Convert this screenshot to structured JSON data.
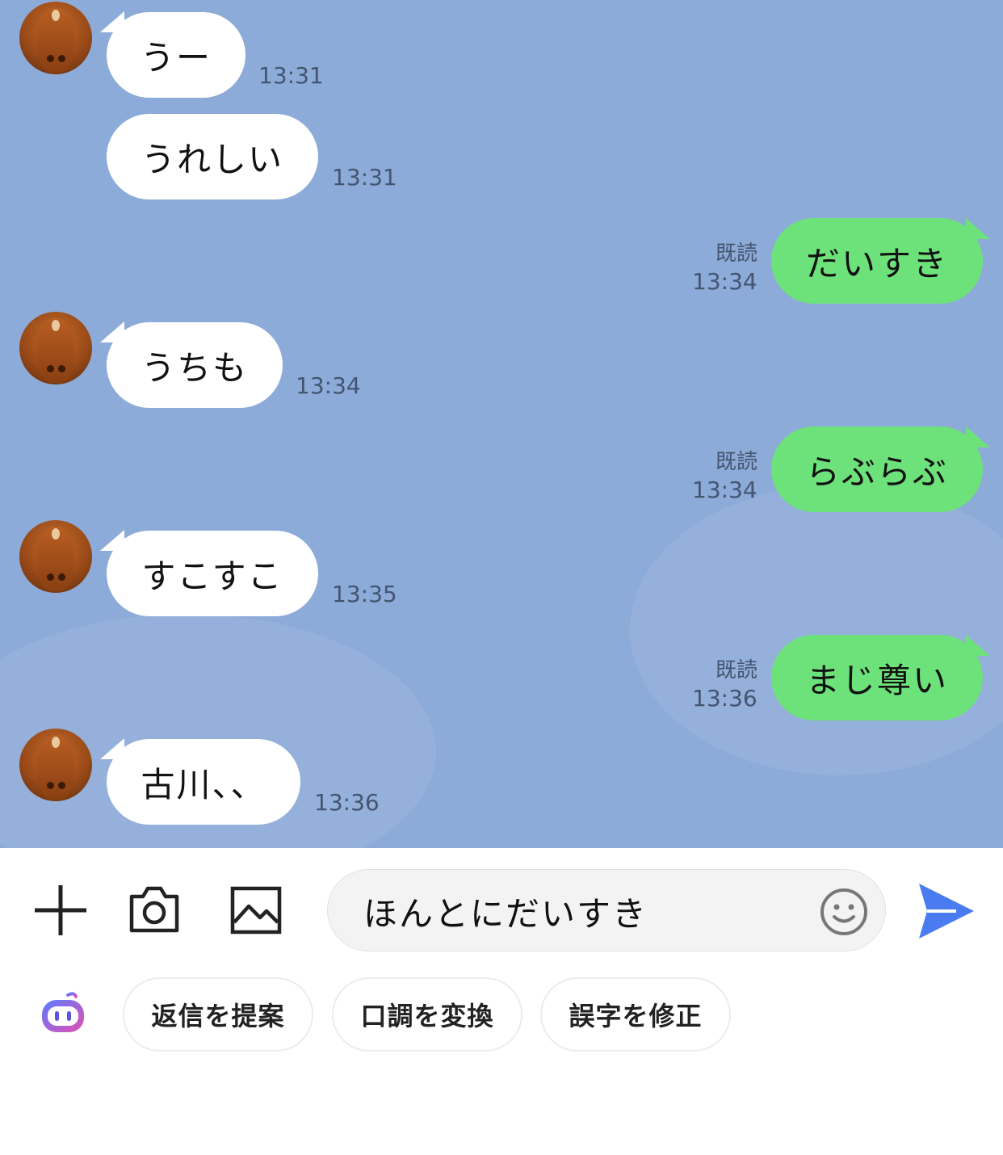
{
  "messages": [
    {
      "side": "in",
      "text": "うー",
      "time": "13:31",
      "avatar": true
    },
    {
      "side": "in",
      "text": "うれしい",
      "time": "13:31",
      "avatar": false
    },
    {
      "side": "out",
      "text": "だいすき",
      "time": "13:34",
      "read": "既読"
    },
    {
      "side": "in",
      "text": "うちも",
      "time": "13:34",
      "avatar": true
    },
    {
      "side": "out",
      "text": "らぶらぶ",
      "time": "13:34",
      "read": "既読"
    },
    {
      "side": "in",
      "text": "すこすこ",
      "time": "13:35",
      "avatar": true
    },
    {
      "side": "out",
      "text": "まじ尊い",
      "time": "13:36",
      "read": "既読"
    },
    {
      "side": "in",
      "text": "古川、、",
      "time": "13:36",
      "avatar": true
    }
  ],
  "composer": {
    "input_value": "ほんとにだいすき",
    "icons": [
      "plus-icon",
      "camera-icon",
      "image-icon",
      "emoji-icon",
      "send-icon",
      "ai-assistant-icon"
    ]
  },
  "ai_chips": [
    {
      "label": "返信を提案"
    },
    {
      "label": "口調を変換"
    },
    {
      "label": "誤字を修正"
    }
  ],
  "colors": {
    "chat_background": "#8dabd8",
    "incoming_bubble": "#ffffff",
    "outgoing_bubble": "#6de27a",
    "send_accent": "#4a7cf0"
  }
}
